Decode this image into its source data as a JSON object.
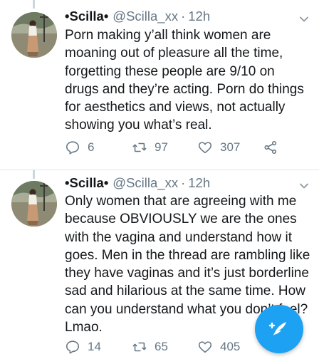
{
  "tweets": [
    {
      "name": "•Scilla•",
      "handle": "@Scilla_xx",
      "separator": "·",
      "time": "12h",
      "lines": [
        "Porn making y’all think women are",
        "moaning out of pleasure all the time,",
        "forgetting these people are 9/10 on",
        "drugs and they’re acting. Porn do things",
        "for aesthetics and views, not actually",
        "showing you what’s real."
      ],
      "replies": "6",
      "retweets": "97",
      "likes": "307",
      "icons": {
        "reply": "reply-icon",
        "retweet": "retweet-icon",
        "like": "heart-icon",
        "share": "share-icon",
        "menu": "chevron-down-icon"
      }
    },
    {
      "name": "•Scilla•",
      "handle": "@Scilla_xx",
      "separator": "·",
      "time": "12h",
      "lines": [
        "Only women that are agreeing with me",
        "because OBVIOUSLY we are the ones",
        "with the vagina and understand how it",
        "goes. Men in the thread are rambling like",
        "they have vaginas and it’s just borderline",
        "sad and hilarious at the same time. How",
        "can you understand what you don’t feel?",
        "Lmao."
      ],
      "replies": "14",
      "retweets": "65",
      "likes": "405",
      "icons": {
        "reply": "reply-icon",
        "retweet": "retweet-icon",
        "like": "heart-icon",
        "menu": "chevron-down-icon"
      }
    }
  ],
  "compose_button": {
    "icon": "compose-tweet-icon",
    "color": "#1da1f2"
  },
  "colors": {
    "text": "#14171a",
    "muted": "#657786",
    "accent": "#1da1f2",
    "divider": "#e1e8ed"
  }
}
